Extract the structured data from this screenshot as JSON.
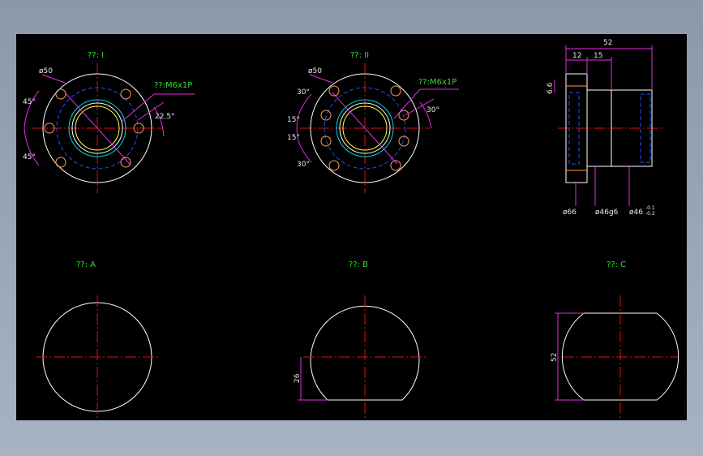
{
  "views": {
    "view_1": {
      "title": "??: I"
    },
    "view_2": {
      "title": "??: II"
    },
    "view_a": {
      "title": "??: A"
    },
    "view_b": {
      "title": "??: B"
    },
    "view_c": {
      "title": "??: C"
    }
  },
  "dimensions": {
    "v1_pcd": "ø50",
    "v1_thread": "??:M6x1P",
    "v1_angle_top": "45°",
    "v1_angle_bottom": "45°",
    "v1_angle_right": "22.5°",
    "v2_pcd": "ø50",
    "v2_thread": "??:M6x1P",
    "v2_angle_30_top": "30°",
    "v2_angle_15_a": "15°",
    "v2_angle_15_b": "15°",
    "v2_angle_30_bottom": "30°",
    "v2_angle_right": "30°",
    "side_total": "52",
    "side_12": "12",
    "side_15": "15",
    "side_66": "6.6",
    "side_d66": "ø66",
    "side_d46g6": "ø46g6",
    "side_d46": "ø46",
    "side_tol_upper": "-0.1",
    "side_tol_lower": "-0.2",
    "b_26": "26",
    "c_52": "52"
  },
  "colors": {
    "background": "#000000",
    "outline": "#ffffff",
    "centerline": "#e01010",
    "hidden": "#2050ff",
    "dimension": "#e030e0",
    "label": "#30e030"
  }
}
